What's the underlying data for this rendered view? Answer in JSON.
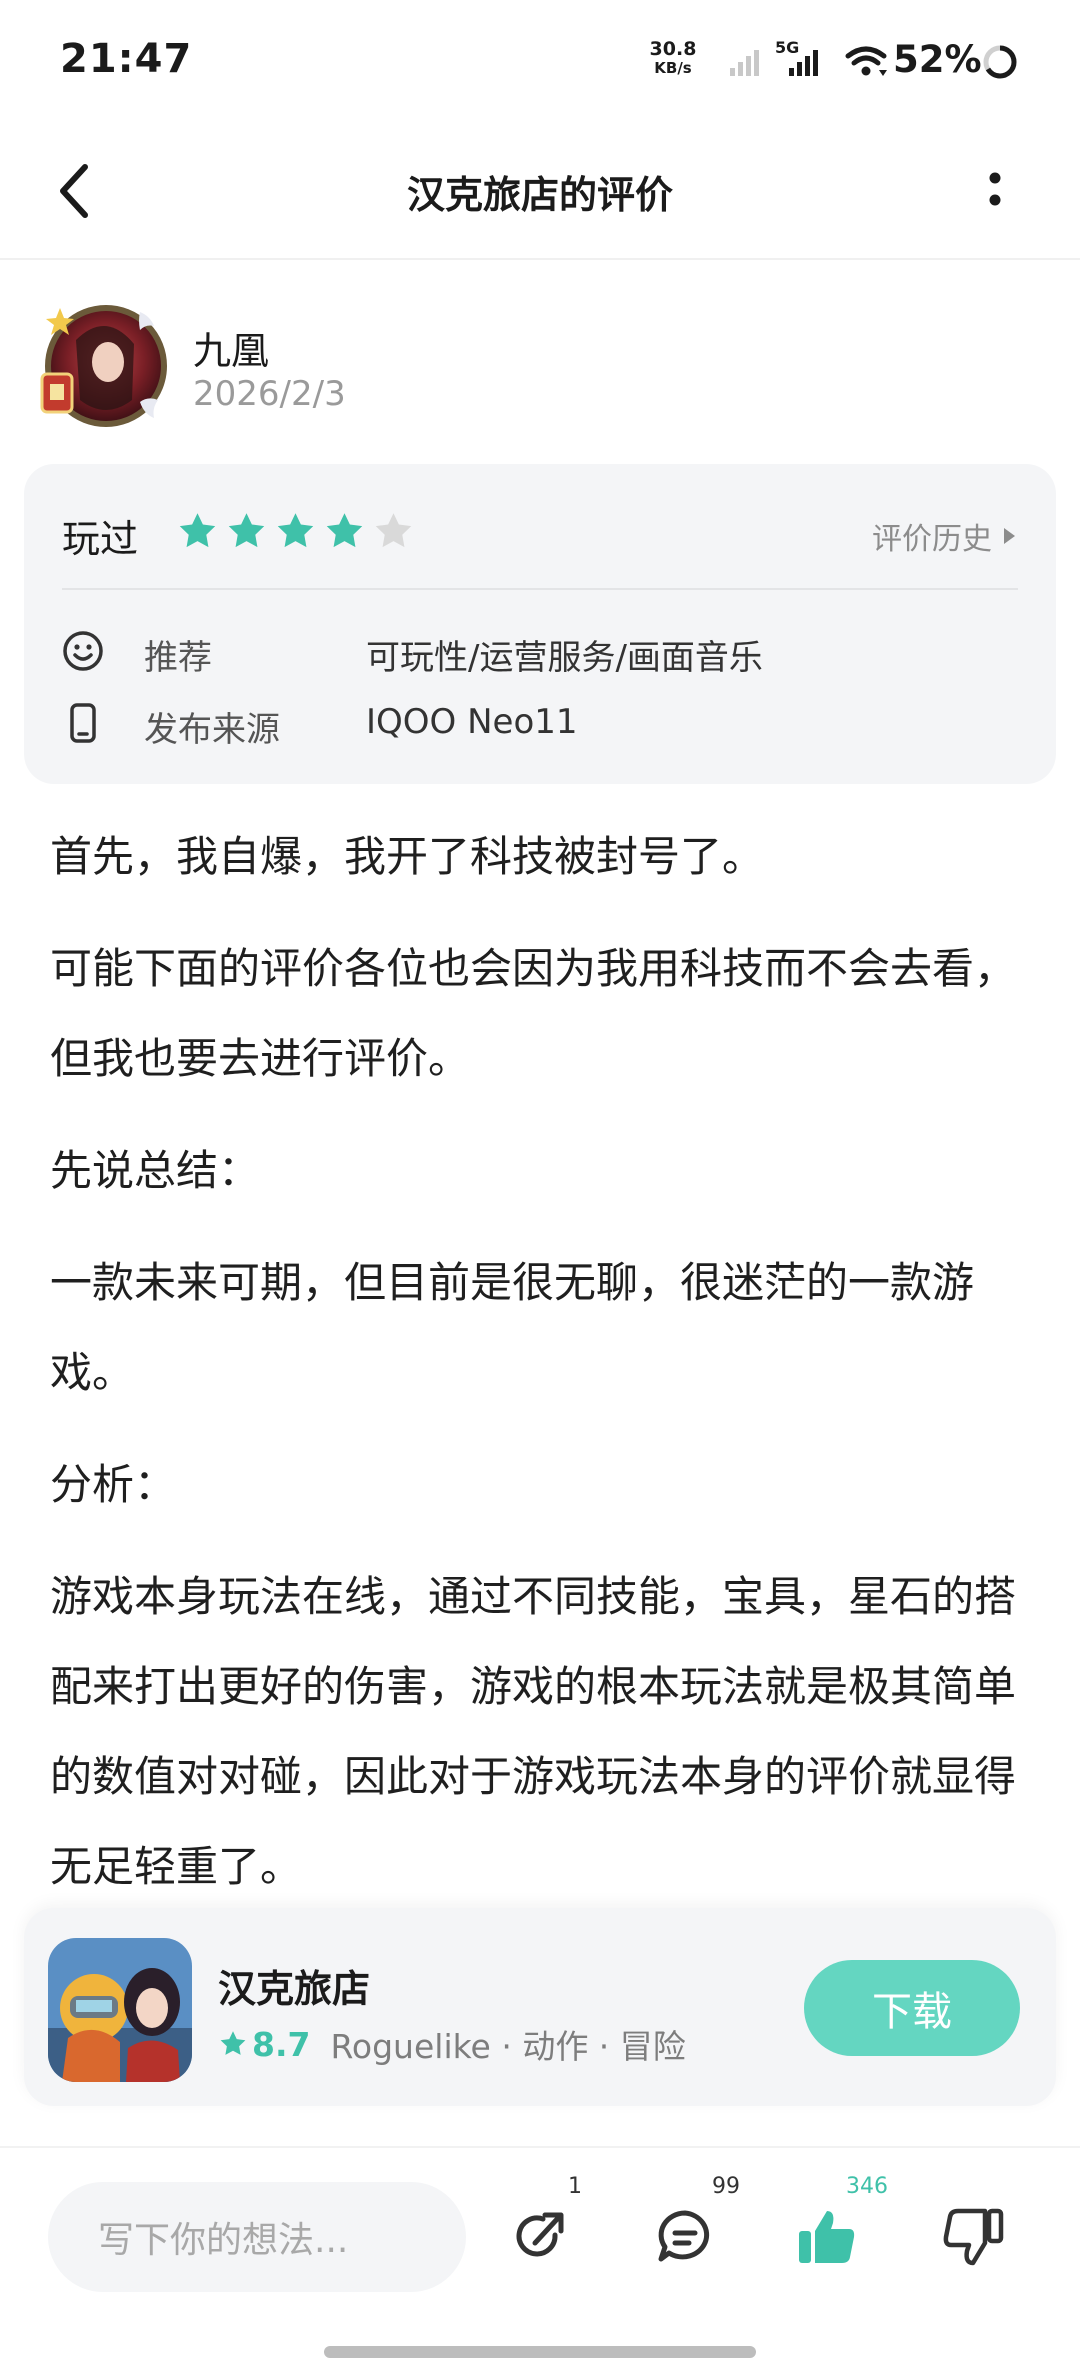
{
  "status_bar": {
    "time": "21:47",
    "net_speed_value": "30.8",
    "net_speed_unit": "KB/s",
    "network_type": "5G",
    "battery_percent": "52%"
  },
  "nav": {
    "title": "汉克旅店的评价"
  },
  "review": {
    "author": "九凰",
    "date": "2026/2/3",
    "played_label": "玩过",
    "rating": 4,
    "rating_max": 5,
    "history_label": "评价历史",
    "recommend_label": "推荐",
    "recommend_value": "可玩性/运营服务/画面音乐",
    "source_label": "发布来源",
    "source_value": "IQOO Neo11",
    "paragraphs": [
      "首先，我自爆，我开了科技被封号了。",
      "可能下面的评价各位也会因为我用科技而不会去看，但我也要去进行评价。",
      "先说总结：",
      "一款未来可期，但目前是很无聊，很迷茫的一款游戏。",
      "分析：",
      "游戏本身玩法在线，通过不同技能，宝具，星石的搭配来打出更好的伤害，游戏的根本玩法就是极其简单的数值对对碰，因此对于游戏玩法本身的评价就显得无足轻重了。"
    ]
  },
  "game_card": {
    "name": "汉克旅店",
    "score": "8.7",
    "tags": "Roguelike · 动作 · 冒险",
    "download_label": "下载"
  },
  "bottom_bar": {
    "input_placeholder": "写下你的想法...",
    "share_count": "1",
    "comment_count": "99",
    "like_count": "346"
  },
  "colors": {
    "accent": "#3fc1a9",
    "download_button": "#64d6c1",
    "card_bg": "#f4f5f7",
    "star_empty": "#d9d9d9"
  },
  "icons": [
    "back-arrow-icon",
    "more-vertical-icon",
    "star-icon",
    "triangle-right-icon",
    "smile-icon",
    "phone-icon",
    "share-icon",
    "comment-icon",
    "thumbs-up-icon",
    "thumbs-down-icon",
    "signal-icon",
    "wifi-icon",
    "battery-icon"
  ]
}
